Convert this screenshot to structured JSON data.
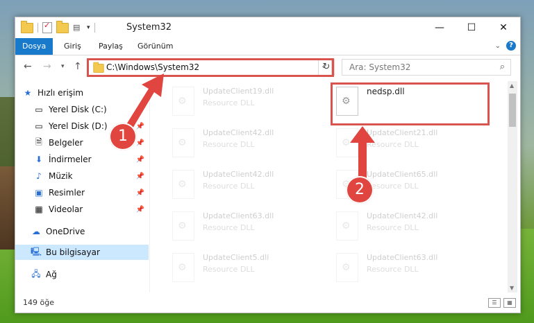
{
  "window": {
    "title": "System32",
    "controls": {
      "minimize": "—",
      "maximize": "☐",
      "close": "✕"
    }
  },
  "ribbon": {
    "tabs": [
      {
        "label": "Dosya"
      },
      {
        "label": "Giriş"
      },
      {
        "label": "Paylaş"
      },
      {
        "label": "Görünüm"
      }
    ],
    "help_label": "?",
    "expand_icon": "chevron-down-icon"
  },
  "address": {
    "path": "C:\\Windows\\System32",
    "search_placeholder": "Ara: System32"
  },
  "sidebar": {
    "quick_access": "Hızlı erişim",
    "items": [
      {
        "label": "Yerel Disk (C:)",
        "icon": "drive-icon"
      },
      {
        "label": "Yerel Disk (D:)",
        "icon": "drive-icon"
      },
      {
        "label": "Belgeler",
        "icon": "documents-icon"
      },
      {
        "label": "İndirmeler",
        "icon": "downloads-icon"
      },
      {
        "label": "Müzik",
        "icon": "music-icon"
      },
      {
        "label": "Resimler",
        "icon": "pictures-icon"
      },
      {
        "label": "Videolar",
        "icon": "videos-icon"
      }
    ],
    "onedrive": "OneDrive",
    "this_pc": "Bu bilgisayar",
    "network": "Ağ"
  },
  "files": [
    {
      "name": "UpdateClient19.dll",
      "type": "Resource DLL"
    },
    {
      "name": "nedsp.dll",
      "type": ""
    },
    {
      "name": "UpdateClient42.dll",
      "type": "Resource DLL"
    },
    {
      "name": "UpdateClient21.dll",
      "type": "Resource DLL"
    },
    {
      "name": "UpdateClient42.dll",
      "type": "Resource DLL"
    },
    {
      "name": "UpdateClient65.dll",
      "type": "Resource DLL"
    },
    {
      "name": "UpdateClient63.dll",
      "type": "Resource DLL"
    },
    {
      "name": "UpdateClient42.dll",
      "type": "Resource DLL"
    },
    {
      "name": "UpdateClient5.dll",
      "type": "Resource DLL"
    },
    {
      "name": "UpdateClient63.dll",
      "type": "Resource DLL"
    }
  ],
  "status": {
    "count": "149 öğe"
  },
  "annotations": {
    "badge1": "1",
    "badge2": "2",
    "color": "#d9534f"
  }
}
